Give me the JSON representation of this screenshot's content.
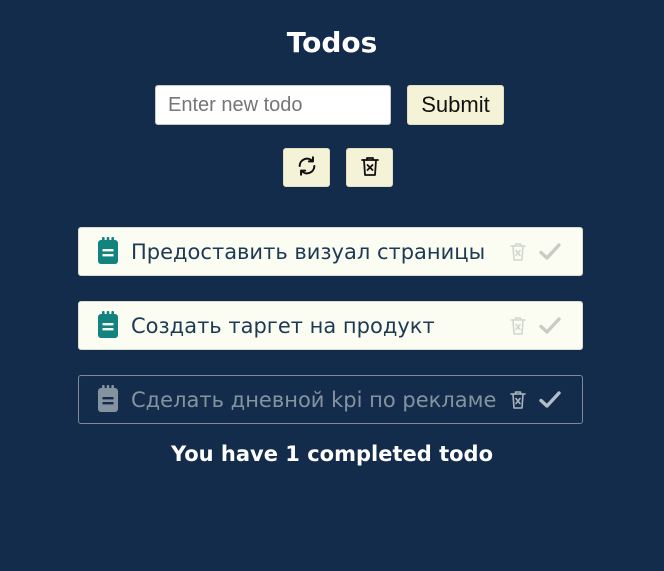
{
  "header": {
    "title": "Todos"
  },
  "form": {
    "input_placeholder": "Enter new todo",
    "input_value": "",
    "submit_label": "Submit",
    "refresh_icon": "refresh-icon",
    "clear_icon": "trash-x-icon"
  },
  "todos": [
    {
      "text": "Предоставить визуал страницы",
      "completed": false,
      "icon": "notepad-icon"
    },
    {
      "text": "Создать таргет на продукт",
      "completed": false,
      "icon": "notepad-icon"
    },
    {
      "text": "Сделать дневной kpi по рекламе",
      "completed": true,
      "icon": "notepad-icon"
    }
  ],
  "footer": {
    "summary": "You have 1 completed todo"
  },
  "colors": {
    "background": "#132c4b",
    "button": "#f5f3d7",
    "todo_active_bg": "#fbfdf3",
    "note_active": "#13837f",
    "note_done": "#8593a1"
  }
}
